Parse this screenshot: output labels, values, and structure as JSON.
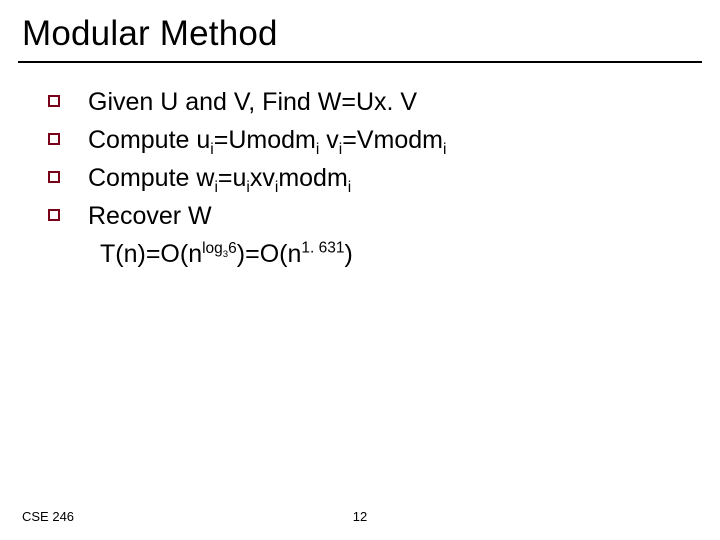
{
  "title": "Modular Method",
  "bullets": [
    {
      "html": "Given U and V, Find W=Ux. V"
    },
    {
      "html": "Compute u<sub>i</sub>=Umodm<sub>i</sub> v<sub>i</sub>=Vmodm<sub>i</sub>"
    },
    {
      "html": "Compute w<sub>i</sub>=u<sub>i</sub>xv<sub>i</sub>modm<sub>i</sub>"
    },
    {
      "html": "Recover W"
    }
  ],
  "tail_line": "T(n)=O(n<sup>log<sub>3</sub>6</sup>)=O(n<sup>1. 631</sup>)",
  "footer": {
    "left": "CSE 246",
    "page": "12"
  },
  "chart_data": {
    "type": "table",
    "title": "Modular Method slide content",
    "rows": [
      "Given U and V, Find W=Ux.V",
      "Compute u_i = U mod m_i ; v_i = V mod m_i",
      "Compute w_i = u_i x v_i mod m_i",
      "Recover W",
      "T(n) = O(n^{log_3 6}) = O(n^{1.631})"
    ],
    "footer_left": "CSE 246",
    "page_number": 12
  }
}
